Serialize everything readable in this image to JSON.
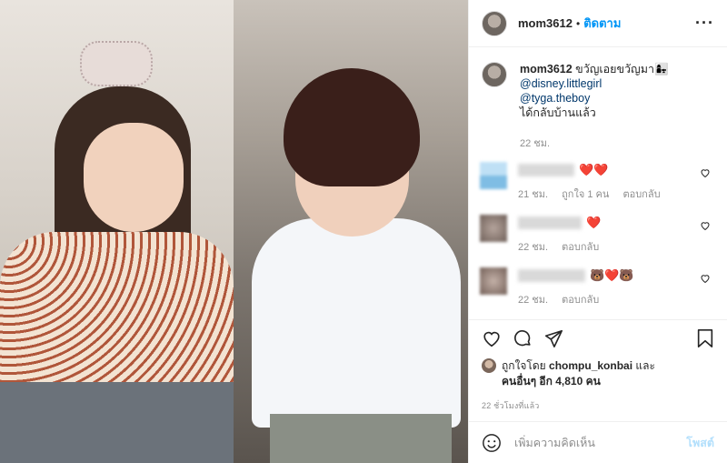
{
  "header": {
    "username": "mom3612",
    "separator": "•",
    "follow_label": "ติดตาม",
    "more_label": "···"
  },
  "caption": {
    "username": "mom3612",
    "text": "ขวัญเอยขวัญมา👩‍👧",
    "mentions": [
      "@disney.littlegirl",
      "@tyga.theboy"
    ],
    "last_line": "ได้กลับบ้านแล้ว",
    "time": "22 ชม."
  },
  "comments": [
    {
      "emoji": "❤️❤️",
      "time": "21 ชม.",
      "likes": "ถูกใจ 1 คน",
      "reply": "ตอบกลับ",
      "like_icon": "heart-outline-icon"
    },
    {
      "emoji": "❤️",
      "time": "22 ชม.",
      "reply": "ตอบกลับ",
      "like_icon": "heart-outline-icon"
    },
    {
      "emoji": "🐻❤️🐻",
      "time": "22 ชม.",
      "reply": "ตอบกลับ",
      "like_icon": "heart-outline-icon"
    }
  ],
  "likes": {
    "prefix": "ถูกใจโดย",
    "user": "chompu_konbai",
    "and": "และ",
    "others": "คนอื่นๆ อีก 4,810 คน"
  },
  "post_time": "22 ชั่วโมงที่แล้ว",
  "add_comment": {
    "placeholder": "เพิ่มความคิดเห็น",
    "post_label": "โพสต์"
  },
  "colors": {
    "link": "#0095f6",
    "heart": "#e0243b",
    "muted": "#8e8e8e",
    "post_disabled": "#b2dffc"
  }
}
